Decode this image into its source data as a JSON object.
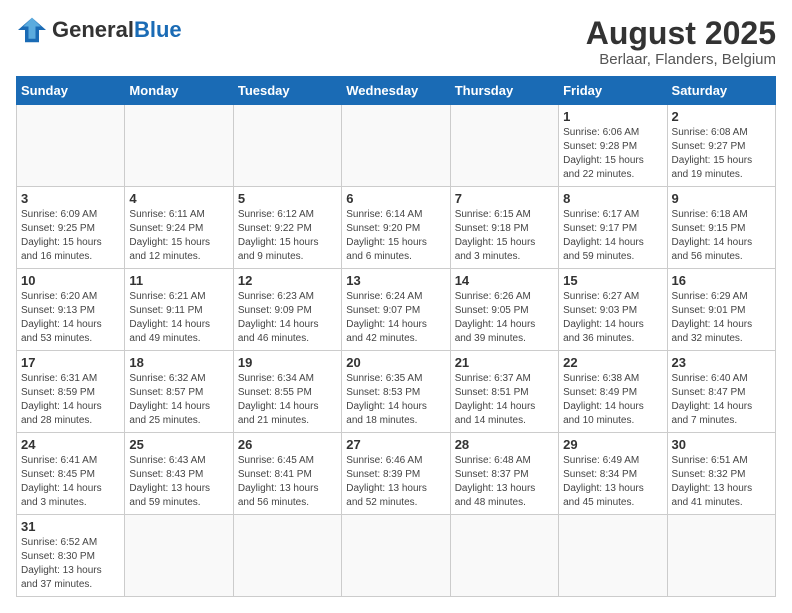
{
  "header": {
    "logo_general": "General",
    "logo_blue": "Blue",
    "title": "August 2025",
    "subtitle": "Berlaar, Flanders, Belgium"
  },
  "days_of_week": [
    "Sunday",
    "Monday",
    "Tuesday",
    "Wednesday",
    "Thursday",
    "Friday",
    "Saturday"
  ],
  "weeks": [
    [
      {
        "day": "",
        "info": ""
      },
      {
        "day": "",
        "info": ""
      },
      {
        "day": "",
        "info": ""
      },
      {
        "day": "",
        "info": ""
      },
      {
        "day": "",
        "info": ""
      },
      {
        "day": "1",
        "info": "Sunrise: 6:06 AM\nSunset: 9:28 PM\nDaylight: 15 hours and 22 minutes."
      },
      {
        "day": "2",
        "info": "Sunrise: 6:08 AM\nSunset: 9:27 PM\nDaylight: 15 hours and 19 minutes."
      }
    ],
    [
      {
        "day": "3",
        "info": "Sunrise: 6:09 AM\nSunset: 9:25 PM\nDaylight: 15 hours and 16 minutes."
      },
      {
        "day": "4",
        "info": "Sunrise: 6:11 AM\nSunset: 9:24 PM\nDaylight: 15 hours and 12 minutes."
      },
      {
        "day": "5",
        "info": "Sunrise: 6:12 AM\nSunset: 9:22 PM\nDaylight: 15 hours and 9 minutes."
      },
      {
        "day": "6",
        "info": "Sunrise: 6:14 AM\nSunset: 9:20 PM\nDaylight: 15 hours and 6 minutes."
      },
      {
        "day": "7",
        "info": "Sunrise: 6:15 AM\nSunset: 9:18 PM\nDaylight: 15 hours and 3 minutes."
      },
      {
        "day": "8",
        "info": "Sunrise: 6:17 AM\nSunset: 9:17 PM\nDaylight: 14 hours and 59 minutes."
      },
      {
        "day": "9",
        "info": "Sunrise: 6:18 AM\nSunset: 9:15 PM\nDaylight: 14 hours and 56 minutes."
      }
    ],
    [
      {
        "day": "10",
        "info": "Sunrise: 6:20 AM\nSunset: 9:13 PM\nDaylight: 14 hours and 53 minutes."
      },
      {
        "day": "11",
        "info": "Sunrise: 6:21 AM\nSunset: 9:11 PM\nDaylight: 14 hours and 49 minutes."
      },
      {
        "day": "12",
        "info": "Sunrise: 6:23 AM\nSunset: 9:09 PM\nDaylight: 14 hours and 46 minutes."
      },
      {
        "day": "13",
        "info": "Sunrise: 6:24 AM\nSunset: 9:07 PM\nDaylight: 14 hours and 42 minutes."
      },
      {
        "day": "14",
        "info": "Sunrise: 6:26 AM\nSunset: 9:05 PM\nDaylight: 14 hours and 39 minutes."
      },
      {
        "day": "15",
        "info": "Sunrise: 6:27 AM\nSunset: 9:03 PM\nDaylight: 14 hours and 36 minutes."
      },
      {
        "day": "16",
        "info": "Sunrise: 6:29 AM\nSunset: 9:01 PM\nDaylight: 14 hours and 32 minutes."
      }
    ],
    [
      {
        "day": "17",
        "info": "Sunrise: 6:31 AM\nSunset: 8:59 PM\nDaylight: 14 hours and 28 minutes."
      },
      {
        "day": "18",
        "info": "Sunrise: 6:32 AM\nSunset: 8:57 PM\nDaylight: 14 hours and 25 minutes."
      },
      {
        "day": "19",
        "info": "Sunrise: 6:34 AM\nSunset: 8:55 PM\nDaylight: 14 hours and 21 minutes."
      },
      {
        "day": "20",
        "info": "Sunrise: 6:35 AM\nSunset: 8:53 PM\nDaylight: 14 hours and 18 minutes."
      },
      {
        "day": "21",
        "info": "Sunrise: 6:37 AM\nSunset: 8:51 PM\nDaylight: 14 hours and 14 minutes."
      },
      {
        "day": "22",
        "info": "Sunrise: 6:38 AM\nSunset: 8:49 PM\nDaylight: 14 hours and 10 minutes."
      },
      {
        "day": "23",
        "info": "Sunrise: 6:40 AM\nSunset: 8:47 PM\nDaylight: 14 hours and 7 minutes."
      }
    ],
    [
      {
        "day": "24",
        "info": "Sunrise: 6:41 AM\nSunset: 8:45 PM\nDaylight: 14 hours and 3 minutes."
      },
      {
        "day": "25",
        "info": "Sunrise: 6:43 AM\nSunset: 8:43 PM\nDaylight: 13 hours and 59 minutes."
      },
      {
        "day": "26",
        "info": "Sunrise: 6:45 AM\nSunset: 8:41 PM\nDaylight: 13 hours and 56 minutes."
      },
      {
        "day": "27",
        "info": "Sunrise: 6:46 AM\nSunset: 8:39 PM\nDaylight: 13 hours and 52 minutes."
      },
      {
        "day": "28",
        "info": "Sunrise: 6:48 AM\nSunset: 8:37 PM\nDaylight: 13 hours and 48 minutes."
      },
      {
        "day": "29",
        "info": "Sunrise: 6:49 AM\nSunset: 8:34 PM\nDaylight: 13 hours and 45 minutes."
      },
      {
        "day": "30",
        "info": "Sunrise: 6:51 AM\nSunset: 8:32 PM\nDaylight: 13 hours and 41 minutes."
      }
    ],
    [
      {
        "day": "31",
        "info": "Sunrise: 6:52 AM\nSunset: 8:30 PM\nDaylight: 13 hours and 37 minutes."
      },
      {
        "day": "",
        "info": ""
      },
      {
        "day": "",
        "info": ""
      },
      {
        "day": "",
        "info": ""
      },
      {
        "day": "",
        "info": ""
      },
      {
        "day": "",
        "info": ""
      },
      {
        "day": "",
        "info": ""
      }
    ]
  ]
}
